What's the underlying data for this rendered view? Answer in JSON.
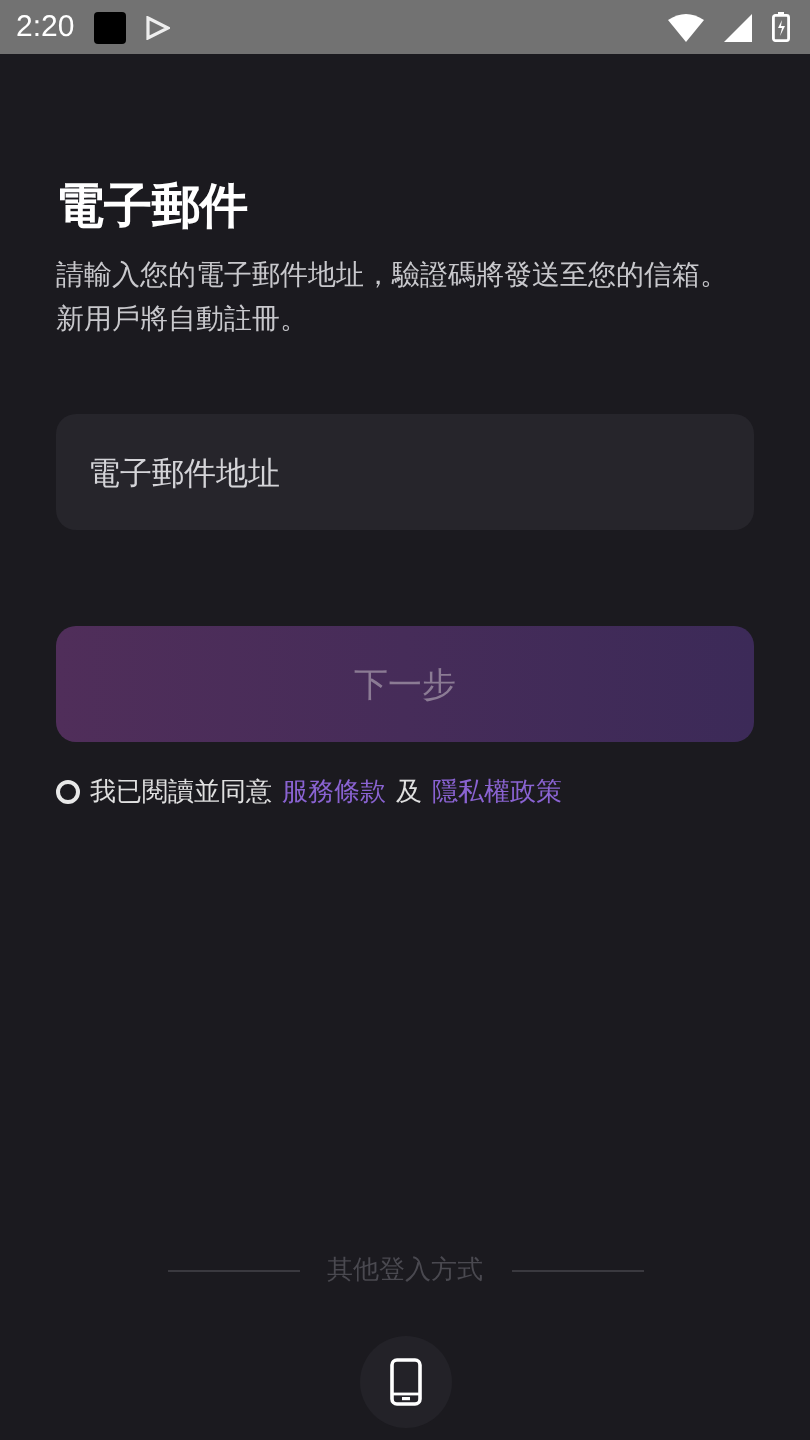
{
  "status_bar": {
    "time": "2:20"
  },
  "title": "電子郵件",
  "subtitle": "請輸入您的電子郵件地址，驗證碼將發送至您的信箱。新用戶將自動註冊。",
  "email_field": {
    "placeholder": "電子郵件地址"
  },
  "next_button": {
    "label": "下一步",
    "disabled": true
  },
  "agreement": {
    "checked": false,
    "text": "我已閱讀並同意",
    "terms_link": "服務條款",
    "joiner": "及",
    "privacy_link": "隱私權政策"
  },
  "other_login": {
    "label": "其他登入方式"
  }
}
